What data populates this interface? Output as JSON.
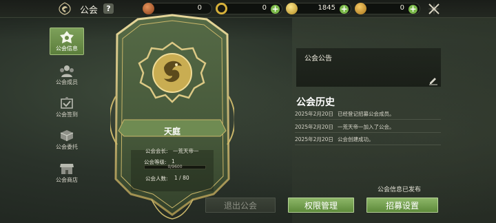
{
  "header": {
    "title": "公会",
    "help_label": "?",
    "currencies": [
      {
        "name": "copper-coin",
        "value": "0",
        "color": "#b5622e",
        "has_plus": false
      },
      {
        "name": "gold-ring",
        "value": "0",
        "color": "#d8b23a",
        "has_plus": true
      },
      {
        "name": "gold-ingot",
        "value": "1845",
        "color": "#e9c444",
        "has_plus": true
      },
      {
        "name": "gold-coin",
        "value": "0",
        "color": "#e1a835",
        "has_plus": true
      }
    ]
  },
  "sidebar": {
    "items": [
      {
        "label": "公会信息",
        "icon": "emblem-icon",
        "active": true
      },
      {
        "label": "公会成员",
        "icon": "members-icon",
        "active": false
      },
      {
        "label": "公会签到",
        "icon": "signin-icon",
        "active": false
      },
      {
        "label": "公会委托",
        "icon": "commission-icon",
        "active": false
      },
      {
        "label": "公会商店",
        "icon": "shop-icon",
        "active": false
      }
    ]
  },
  "guild": {
    "name": "天庭",
    "leader_label": "公会会长:",
    "leader": "一荒天帝一",
    "level_label": "公会等级:",
    "level": "1",
    "exp_text": "0/9600",
    "exp_progress": 0,
    "members_label": "公会人数:",
    "members": "1 / 80"
  },
  "notice": {
    "title": "公会公告"
  },
  "history": {
    "title": "公会历史",
    "rows": [
      {
        "date": "2025年2月20日",
        "text": "已经登记招募公会成员。"
      },
      {
        "date": "2025年2月20日",
        "text": "一荒天帝一加入了公会。"
      },
      {
        "date": "2025年2月20日",
        "text": "公会创建成功。"
      }
    ]
  },
  "status": "公会信息已发布",
  "buttons": {
    "quit": "退出公会",
    "permissions": "权限管理",
    "recruit": "招募设置"
  },
  "colors": {
    "accent_green": "#7aa24a",
    "gold_frame": "#c9b66a"
  }
}
